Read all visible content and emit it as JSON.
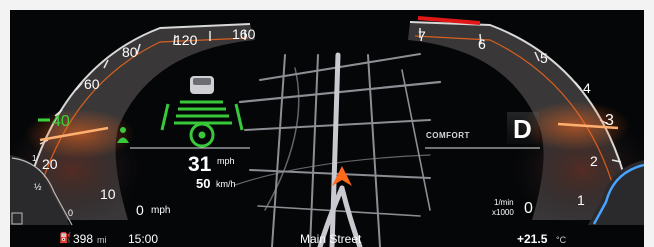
{
  "speedometer": {
    "ticks": [
      "160",
      "120",
      "80",
      "60",
      "40",
      "20",
      "10",
      "0"
    ],
    "zero_unit": "mph",
    "active_speed": "40",
    "needle_color": "#ff7a1e",
    "active_color": "#39d23a"
  },
  "fuel_gauge": {
    "labels": [
      "1",
      "½",
      "0"
    ]
  },
  "driver_assist": {
    "status_color": "#38c83a",
    "icons": [
      "lead-car-icon",
      "lane-lines-icon",
      "steering-wheel-icon",
      "driver-alert-icon"
    ]
  },
  "speed_readout": {
    "primary_value": "31",
    "primary_unit": "mph",
    "secondary_value": "50",
    "secondary_unit": "km/h"
  },
  "tachometer": {
    "ticks": [
      "7",
      "6",
      "5",
      "4",
      "3",
      "2",
      "1",
      "0"
    ],
    "unit_top": "1/min",
    "unit_bottom": "x1000",
    "redline_color": "#e01818"
  },
  "drive_mode": {
    "label": "COMFORT",
    "gear": "D"
  },
  "navigation": {
    "street": "Main Street",
    "position_marker_color": "#ff6a1a"
  },
  "status_bar": {
    "range_value": "398",
    "range_unit": "mi",
    "clock": "15:00",
    "temperature": "+21.5",
    "temperature_unit": "°C"
  }
}
